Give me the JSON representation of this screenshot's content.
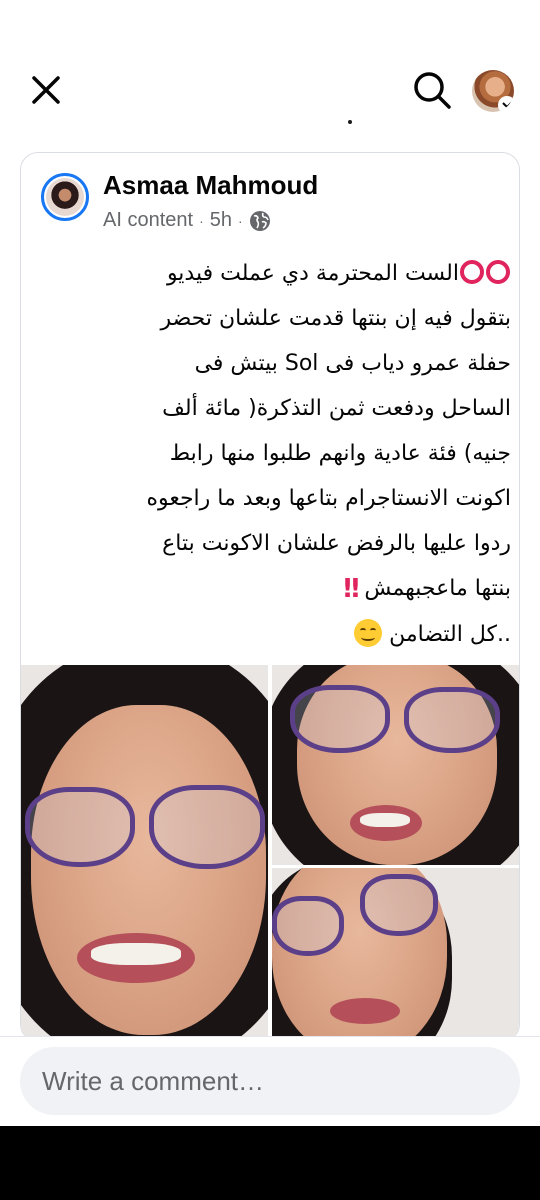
{
  "header": {
    "close_icon": "close-icon",
    "search_icon": "search-icon",
    "profile_icon": "avatar"
  },
  "post": {
    "author": "Asmaa Mahmoud",
    "label": "AI content",
    "time": "5h",
    "audience_icon": "globe-icon",
    "text_line1": "الست المحترمة دي عملت فيديو",
    "text_line2": "بتقول فيه إن بنتها قدمت علشان تحضر",
    "text_line3": "حفلة عمرو دياب فى Sol بيتش فى",
    "text_line4": "الساحل ودفعت ثمن التذكرة( مائة ألف",
    "text_line5": "جنيه) فئة عادية وانهم طلبوا منها رابط",
    "text_line6": "اكونت الانستاجرام بتاعها وبعد ما راجعوه",
    "text_line7": "ردوا عليها بالرفض علشان الاكونت بتاع",
    "text_line8": "بنتها ماعجبهمش",
    "text_line9": "..كل التضامن"
  },
  "comment": {
    "placeholder": "Write a comment…"
  },
  "colors": {
    "accent": "#1877f2",
    "emoji_red": "#e0245e",
    "glasses": "#5b3f88"
  }
}
